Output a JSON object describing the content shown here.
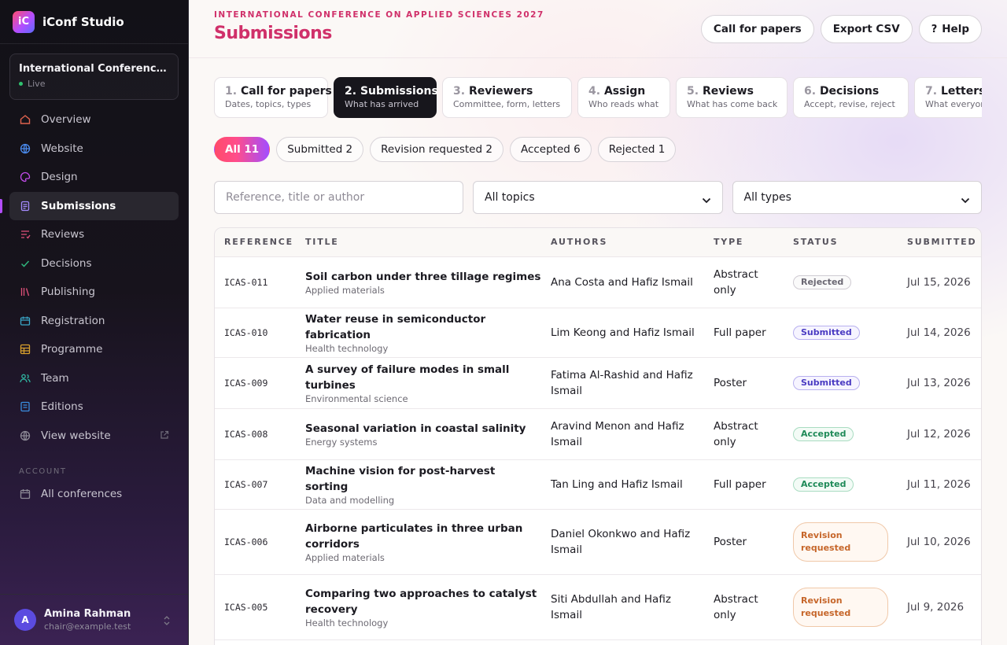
{
  "app": {
    "logo_text": "iC",
    "name": "iConf Studio"
  },
  "conference": {
    "title": "International Conference on Applied Sciences 2027",
    "status": "Live"
  },
  "nav": [
    {
      "label": "Overview",
      "icon": "home-icon"
    },
    {
      "label": "Website",
      "icon": "globe-icon"
    },
    {
      "label": "Design",
      "icon": "palette-icon"
    },
    {
      "label": "Submissions",
      "icon": "document-icon",
      "active": true
    },
    {
      "label": "Reviews",
      "icon": "reviews-icon"
    },
    {
      "label": "Decisions",
      "icon": "check-icon"
    },
    {
      "label": "Publishing",
      "icon": "books-icon"
    },
    {
      "label": "Registration",
      "icon": "ticket-icon"
    },
    {
      "label": "Programme",
      "icon": "grid-icon"
    },
    {
      "label": "Team",
      "icon": "users-icon"
    },
    {
      "label": "Editions",
      "icon": "list-icon"
    },
    {
      "label": "View website",
      "icon": "globe-icon"
    }
  ],
  "account": {
    "section_label": "ACCOUNT",
    "items": [
      {
        "label": "All conferences",
        "icon": "calendar-icon"
      }
    ]
  },
  "user": {
    "initial": "A",
    "name": "Amina Rahman",
    "email": "chair@example.test"
  },
  "header": {
    "eyebrow": "INTERNATIONAL CONFERENCE ON APPLIED SCIENCES 2027",
    "title": "Submissions",
    "actions": {
      "call_for_papers": "Call for papers",
      "export": "Export CSV",
      "help": "Help",
      "help_glyph": "?"
    }
  },
  "steps": [
    {
      "num": "1.",
      "title": "Call for papers",
      "sub": "Dates, topics, types"
    },
    {
      "num": "2.",
      "title": "Submissions",
      "sub": "What has arrived",
      "active": true
    },
    {
      "num": "3.",
      "title": "Reviewers",
      "sub": "Committee, form, letters"
    },
    {
      "num": "4.",
      "title": "Assign",
      "sub": "Who reads what"
    },
    {
      "num": "5.",
      "title": "Reviews",
      "sub": "What has come back"
    },
    {
      "num": "6.",
      "title": "Decisions",
      "sub": "Accept, revise, reject"
    },
    {
      "num": "7.",
      "title": "Letters",
      "sub": "What everyone receives"
    }
  ],
  "filters": [
    "All 11",
    "Submitted 2",
    "Revision requested 2",
    "Accepted 6",
    "Rejected 1"
  ],
  "search": {
    "placeholder": "Reference, title or author",
    "topic_select": "All topics",
    "type_select": "All types"
  },
  "table": {
    "columns": [
      "REFERENCE",
      "TITLE",
      "AUTHORS",
      "TYPE",
      "STATUS",
      "SUBMITTED"
    ],
    "rows": [
      {
        "ref": "ICAS-011",
        "title": "Soil carbon under three tillage regimes",
        "topic": "Applied materials",
        "authors": "Ana Costa and Hafiz Ismail",
        "type": "Abstract only",
        "status": "Rejected",
        "date": "Jul 15, 2026"
      },
      {
        "ref": "ICAS-010",
        "title": "Water reuse in semiconductor fabrication",
        "topic": "Health technology",
        "authors": "Lim Keong and Hafiz Ismail",
        "type": "Full paper",
        "status": "Submitted",
        "date": "Jul 14, 2026"
      },
      {
        "ref": "ICAS-009",
        "title": "A survey of failure modes in small turbines",
        "topic": "Environmental science",
        "authors": "Fatima Al-Rashid and Hafiz Ismail",
        "type": "Poster",
        "status": "Submitted",
        "date": "Jul 13, 2026"
      },
      {
        "ref": "ICAS-008",
        "title": "Seasonal variation in coastal salinity",
        "topic": "Energy systems",
        "authors": "Aravind Menon and Hafiz Ismail",
        "type": "Abstract only",
        "status": "Accepted",
        "date": "Jul 12, 2026"
      },
      {
        "ref": "ICAS-007",
        "title": "Machine vision for post-harvest sorting",
        "topic": "Data and modelling",
        "authors": "Tan Ling and Hafiz Ismail",
        "type": "Full paper",
        "status": "Accepted",
        "date": "Jul 11, 2026"
      },
      {
        "ref": "ICAS-006",
        "title": "Airborne particulates in three urban corridors",
        "topic": "Applied materials",
        "authors": "Daniel Okonkwo and Hafiz Ismail",
        "type": "Poster",
        "status": "Revision requested",
        "date": "Jul 10, 2026"
      },
      {
        "ref": "ICAS-005",
        "title": "Comparing two approaches to catalyst recovery",
        "topic": "Health technology",
        "authors": "Siti Abdullah and Hafiz Ismail",
        "type": "Abstract only",
        "status": "Revision requested",
        "date": "Jul 9, 2026"
      }
    ]
  },
  "colors": {
    "accent": "#d0306a",
    "sidebar": "#121117",
    "active_step": "#17161c",
    "submitted": "#4a3bc2",
    "accepted": "#1f8a58",
    "revision": "#c6662a"
  }
}
